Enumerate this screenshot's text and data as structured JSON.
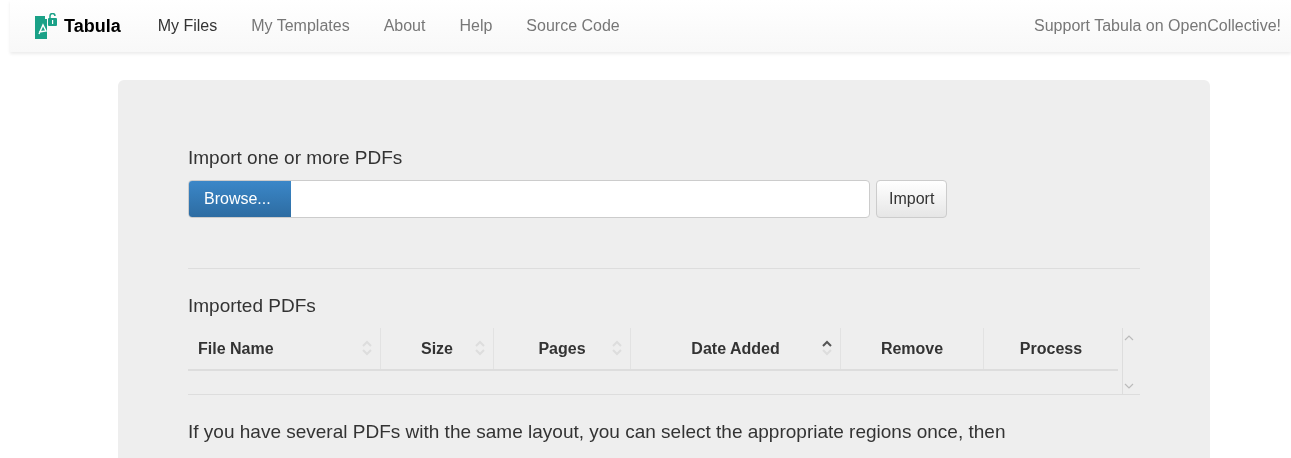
{
  "navbar": {
    "brand": "Tabula",
    "items": [
      {
        "label": "My Files",
        "selected": true
      },
      {
        "label": "My Templates",
        "selected": false
      },
      {
        "label": "About",
        "selected": false
      },
      {
        "label": "Help",
        "selected": false
      },
      {
        "label": "Source Code",
        "selected": false
      }
    ],
    "support_link": "Support Tabula on OpenCollective!"
  },
  "import": {
    "heading": "Import one or more PDFs",
    "browse_button": "Browse...",
    "import_button": "Import"
  },
  "imported": {
    "heading": "Imported PDFs",
    "columns": [
      {
        "label": "File Name",
        "sortable": true,
        "sorted_ascending": false
      },
      {
        "label": "Size",
        "sortable": true,
        "sorted_ascending": false
      },
      {
        "label": "Pages",
        "sortable": true,
        "sorted_ascending": false
      },
      {
        "label": "Date Added",
        "sortable": true,
        "sorted_ascending": true
      },
      {
        "label": "Remove",
        "sortable": false,
        "sorted_ascending": false
      },
      {
        "label": "Process",
        "sortable": false,
        "sorted_ascending": false
      }
    ]
  },
  "intro_text": "If you have several PDFs with the same layout, you can select the appropriate regions once, then"
}
